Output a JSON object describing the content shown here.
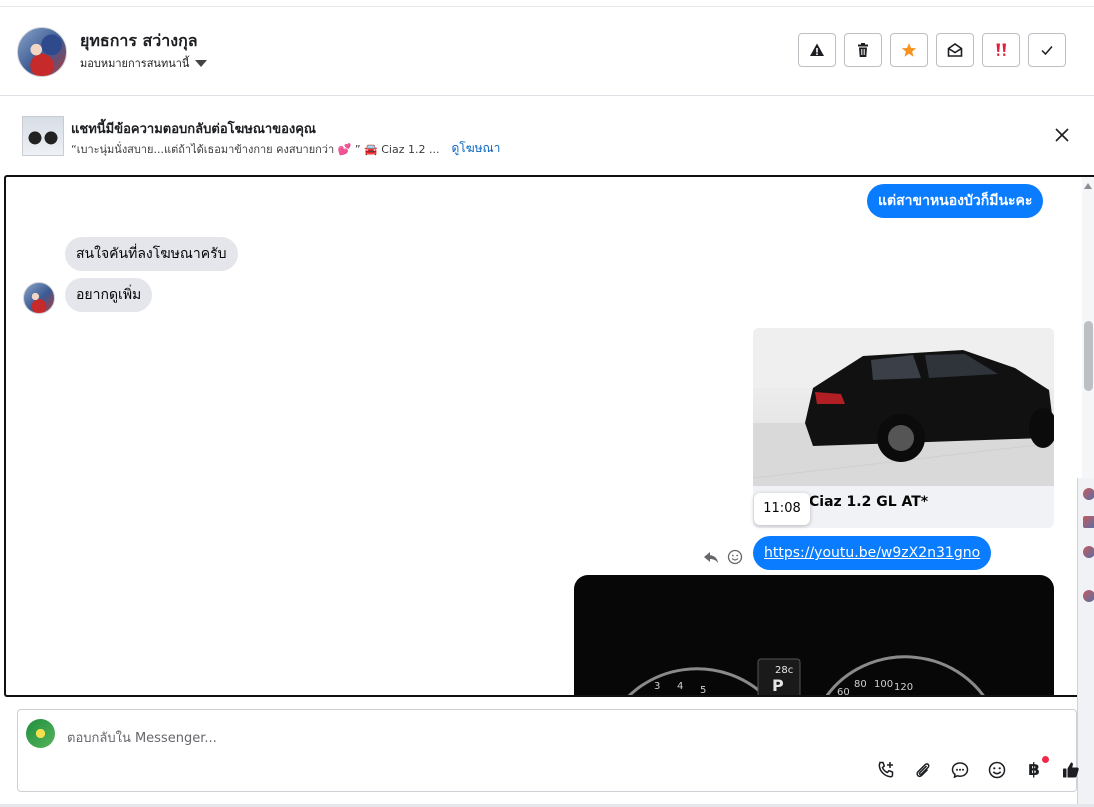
{
  "header": {
    "contact_name": "ยุทธการ สว่างกุล",
    "assign_label": "มอบหมายการสนทนานี้",
    "actions": [
      {
        "icon": "warning-icon"
      },
      {
        "icon": "trash-icon"
      },
      {
        "icon": "star-icon",
        "color": "#f7931e"
      },
      {
        "icon": "mark-unread-icon"
      },
      {
        "icon": "priority-icon",
        "color": "#e41e3f"
      },
      {
        "icon": "check-icon"
      }
    ]
  },
  "ad_banner": {
    "title": "แชทนี้มีข้อความตอบกลับต่อโฆษณาของคุณ",
    "quote": "“เบาะนุ่มนั่งสบาย...แต่ถ้าได้เธอมาข้างกาย คงสบายกว่า 💕 ” 🚘 Ciaz 1.2 ...",
    "link_label": "ดูโฆษณา"
  },
  "messages": {
    "outgoing_1": "แต่สาขาหนองบัวก็มีนะคะ",
    "incoming_1": "สนใจคันที่ลงโฆษณาครับ",
    "incoming_2": "อยากดูเพิ่ม",
    "car_caption": "Ciaz 1.2 GL AT*",
    "timestamp_tooltip": "11:08",
    "link_message": "https://youtu.be/w9zX2n31gno",
    "dashboard_readout": "28c",
    "gear_indicator": "P"
  },
  "composer": {
    "placeholder": "ตอบกลับใน Messenger...",
    "tools": [
      "call-add-icon",
      "attachment-icon",
      "saved-reply-icon",
      "emoji-icon",
      "baht-payment-icon",
      "thumbs-up-icon"
    ],
    "baht_symbol": "฿"
  },
  "colors": {
    "outgoing_bubble": "#0a7cff",
    "incoming_bubble": "#e4e6eb",
    "link": "#0a66c2"
  }
}
